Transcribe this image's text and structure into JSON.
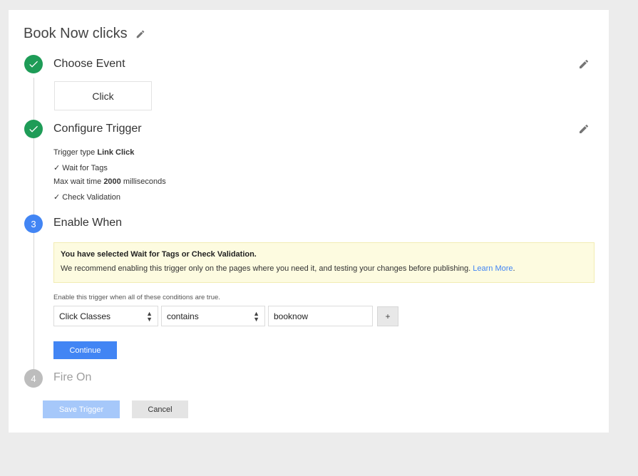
{
  "trigger_name": "Book Now clicks",
  "steps": [
    {
      "number": "",
      "title": "Choose Event",
      "status": "done"
    },
    {
      "number": "",
      "title": "Configure Trigger",
      "status": "done"
    },
    {
      "number": "3",
      "title": "Enable When",
      "status": "active"
    },
    {
      "number": "4",
      "title": "Fire On",
      "status": "pending"
    }
  ],
  "choose_event": {
    "selected": "Click"
  },
  "configure_trigger": {
    "type_label": "Trigger type",
    "type_value": "Link Click",
    "check_mark": "✓",
    "wait_for_tags": "Wait for Tags",
    "max_wait_label": "Max wait time",
    "max_wait_value": "2000",
    "max_wait_unit": "milliseconds",
    "check_validation": "Check Validation"
  },
  "notice": {
    "title": "You have selected Wait for Tags or Check Validation.",
    "body": "We recommend enabling this trigger only on the pages where you need it, and testing your changes before publishing.",
    "link": "Learn More",
    "end": "."
  },
  "condition": {
    "label": "Enable this trigger when all of these conditions are true.",
    "variable": "Click Classes",
    "operator": "contains",
    "value": "booknow",
    "add_label": "+"
  },
  "buttons": {
    "continue": "Continue",
    "save": "Save Trigger",
    "cancel": "Cancel"
  },
  "colors": {
    "done": "#1e9c57",
    "active": "#4285f4",
    "pending": "#bdbdbd",
    "notice_bg": "#fdfbe0"
  }
}
